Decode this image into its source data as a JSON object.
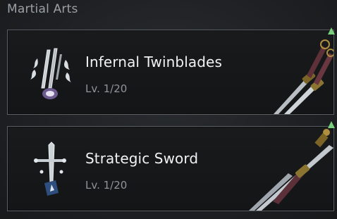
{
  "section": {
    "title": "Martial Arts"
  },
  "skills": [
    {
      "name": "Infernal Twinblades",
      "level": "Lv. 1/20",
      "icon": "twinblades-icon",
      "weapon": "twin-swords-image"
    },
    {
      "name": "Strategic Sword",
      "level": "Lv. 1/20",
      "icon": "sword-icon",
      "weapon": "long-sword-image"
    }
  ],
  "colors": {
    "upgrade_arrow": "#7ad07c",
    "card_border": "#5a5f64"
  }
}
